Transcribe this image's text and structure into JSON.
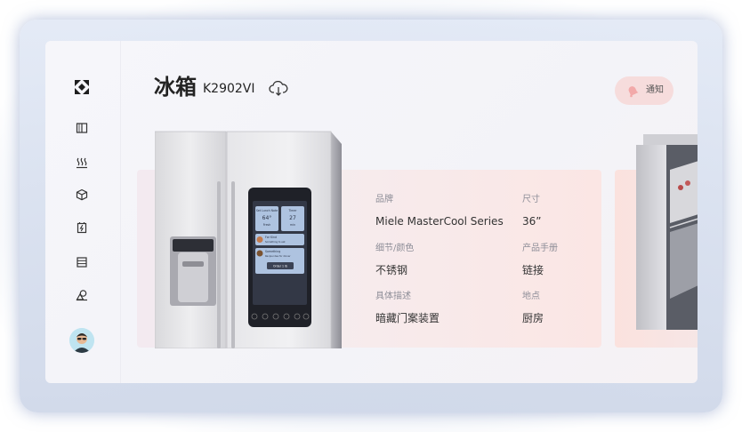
{
  "header": {
    "title": "冰箱",
    "model": "K2902VI",
    "notify_label": "通知"
  },
  "sidebar": {
    "logo": "brand-logo-icon",
    "items": [
      {
        "icon": "book-icon"
      },
      {
        "icon": "heat-waves-icon"
      },
      {
        "icon": "cube-icon"
      },
      {
        "icon": "battery-charging-icon"
      },
      {
        "icon": "list-icon"
      },
      {
        "icon": "shapes-icon"
      }
    ]
  },
  "product": {
    "brand_label": "品牌",
    "brand_value": "Miele MasterCool Series",
    "size_label": "尺寸",
    "size_value": "36”",
    "finish_label": "细节/颜色",
    "finish_value": "不锈钢",
    "manual_label": "产品手册",
    "manual_value": "链接",
    "desc_label": "具体描述",
    "desc_value": "暗藏门案装置",
    "location_label": "地点",
    "location_value": "厨房"
  },
  "screen": {
    "tile1_title": "Set Lunch Note",
    "tile1_value": "64°",
    "tile1_sub": "Fresh",
    "tile2_title": "Timer",
    "tile2_value": "27",
    "tile2_sub": "min",
    "row1_title": "For Kind",
    "row1_sub": "Something to eat",
    "row2_title": "Something",
    "row2_sub": "Recipe idea for dinner",
    "order_button": "Order 1 lb"
  },
  "colors": {
    "accent_pink": "#f6dcdc",
    "text_dark": "#232323",
    "label_gray": "#8e8e98"
  }
}
